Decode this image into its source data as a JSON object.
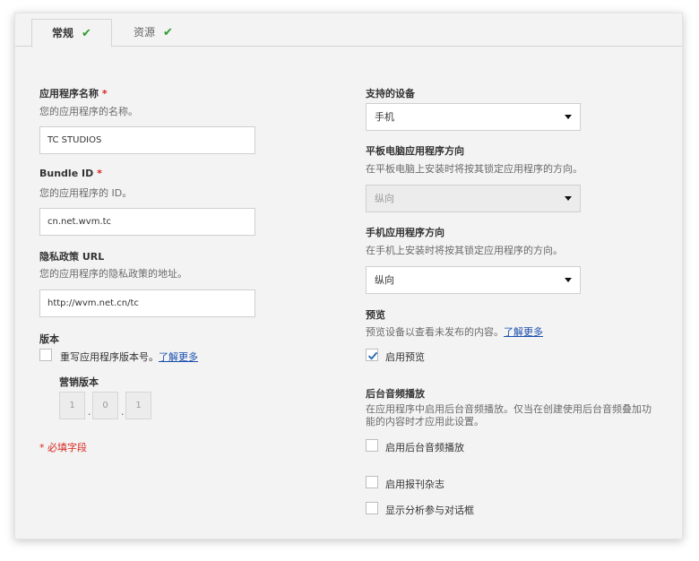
{
  "tabs": [
    {
      "label": "常规",
      "check": "✔"
    },
    {
      "label": "资源",
      "check": "✔"
    }
  ],
  "left": {
    "app_name": {
      "label": "应用程序名称",
      "required": "*",
      "desc": "您的应用程序的名称。",
      "value": "TC STUDIOS"
    },
    "bundle_id": {
      "label": "Bundle ID",
      "required": "*",
      "desc": "您的应用程序的 ID。",
      "value": "cn.net.wvm.tc"
    },
    "privacy_url": {
      "label": "隐私政策 URL",
      "desc": "您的应用程序的隐私政策的地址。",
      "value": "http://wvm.net.cn/tc"
    },
    "version": {
      "label": "版本",
      "override_label": "重写应用程序版本号。",
      "learn_more": "了解更多",
      "override_checked": false,
      "marketing_label": "营销版本",
      "parts": [
        "1",
        "0",
        "1"
      ],
      "separator": "."
    },
    "required_note": "* 必填字段"
  },
  "right": {
    "devices": {
      "label": "支持的设备",
      "value": "手机"
    },
    "tablet_orientation": {
      "label": "平板电脑应用程序方向",
      "desc": "在平板电脑上安装时将按其锁定应用程序的方向。",
      "value": "纵向",
      "disabled": true
    },
    "phone_orientation": {
      "label": "手机应用程序方向",
      "desc": "在手机上安装时将按其锁定应用程序的方向。",
      "value": "纵向"
    },
    "preview": {
      "label": "预览",
      "desc": "预览设备以查看未发布的内容。",
      "learn_more": "了解更多",
      "checkbox_label": "启用预览",
      "checked": true
    },
    "background_audio": {
      "label": "后台音频播放",
      "desc": "在应用程序中启用后台音频播放。仅当在创建使用后台音频叠加功能的内容时才应用此设置。",
      "checkbox_label": "启用后台音频播放",
      "checked": false
    },
    "newsstand": {
      "checkbox_label": "启用报刊杂志",
      "checked": false
    },
    "analytics_dialog": {
      "checkbox_label": "显示分析参与对话框",
      "checked": false
    }
  },
  "colors": {
    "accent_check": "#2e9b2e",
    "required": "#d9261c",
    "link": "#1a4fae",
    "checkbox_tick": "#2f6fb5"
  }
}
